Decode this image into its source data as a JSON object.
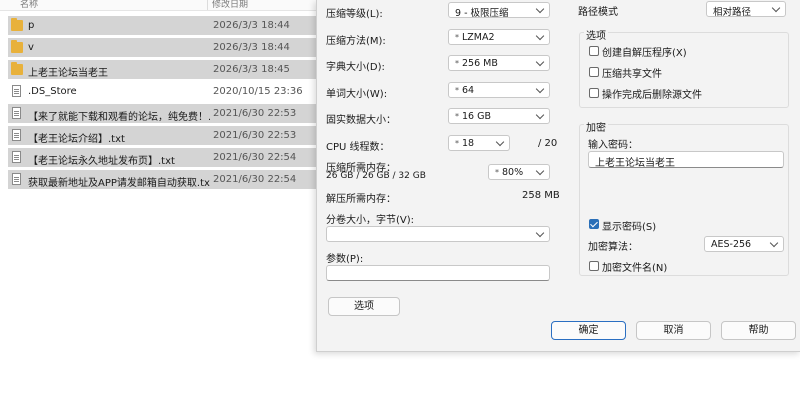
{
  "explorer": {
    "columns": {
      "name": "名称",
      "date": "修改日期"
    },
    "files": [
      {
        "icon": "folder",
        "name": "p",
        "date": "2026/3/3 18:44",
        "selected": true
      },
      {
        "icon": "folder",
        "name": "v",
        "date": "2026/3/3 18:44",
        "selected": true
      },
      {
        "icon": "folder",
        "name": "上老王论坛当老王",
        "date": "2026/3/3 18:45",
        "selected": true
      },
      {
        "icon": "document",
        "name": ".DS_Store",
        "date": "2020/10/15 23:36",
        "selected": false
      },
      {
        "icon": "document",
        "name": "【来了就能下载和观看的论坛，纯免费！...",
        "date": "2021/6/30 22:53",
        "selected": true
      },
      {
        "icon": "document",
        "name": "【老王论坛介绍】.txt",
        "date": "2021/6/30 22:53",
        "selected": true
      },
      {
        "icon": "document",
        "name": "【老王论坛永久地址发布页】.txt",
        "date": "2021/6/30 22:54",
        "selected": true
      },
      {
        "icon": "document",
        "name": "获取最新地址及APP请发邮箱自动获取.txt",
        "date": "2021/6/30 22:54",
        "selected": true
      }
    ]
  },
  "dialog": {
    "level_label": "压缩等级(L):",
    "level_value": "9 - 极限压缩",
    "method_label": "压缩方法(M):",
    "method_value": "LZMA2",
    "dict_label": "字典大小(D):",
    "dict_value": "256 MB",
    "word_label": "单词大小(W):",
    "word_value": "64",
    "solid_label": "固实数据大小：",
    "solid_value": "16 GB",
    "threads_label": "CPU 线程数：",
    "threads_value": "18",
    "threads_max": "/ 20",
    "mem_compress_label": "压缩所需内存：",
    "mem_compress_detail": "26 GB / 26 GB / 32 GB",
    "mem_percent": "80%",
    "mem_decompress_label": "解压所需内存：",
    "mem_decompress_value": "258 MB",
    "split_label": "分卷大小，字节(V):",
    "split_value": "",
    "params_label": "参数(P):",
    "params_value": "",
    "options_button": "选项",
    "path_mode_label": "路径模式",
    "path_mode_value": "相对路径",
    "options_group": "选项",
    "opt_sfx": "创建自解压程序(X)",
    "opt_shared": "压缩共享文件",
    "opt_delete": "操作完成后删除源文件",
    "encrypt_group": "加密",
    "password_label": "输入密码：",
    "password_value": "上老王论坛当老王",
    "show_password": "显示密码(S)",
    "enc_method_label": "加密算法：",
    "enc_method_value": "AES-256",
    "encrypt_names": "加密文件名(N)",
    "ok_button": "确定",
    "cancel_button": "取消",
    "help_button": "帮助",
    "star": "*"
  }
}
